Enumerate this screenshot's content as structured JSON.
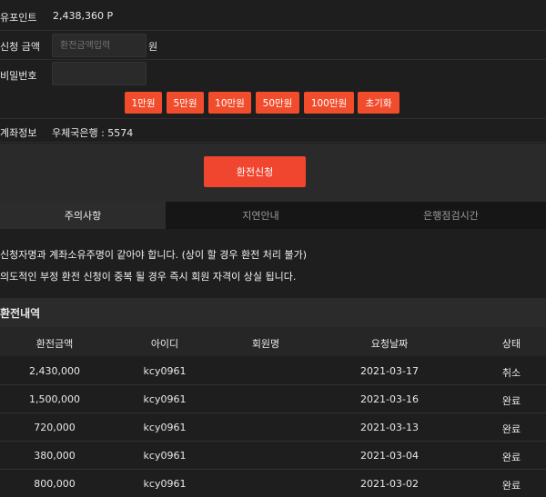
{
  "form": {
    "points_label": "유포인트",
    "points_value": "2,438,360 P",
    "amount_label": "신청 금액",
    "amount_placeholder": "환전금액입력",
    "amount_unit": "원",
    "password_label": "비밀번호",
    "account_label": "계좌정보",
    "account_value": "우체국은행 : 5574"
  },
  "amount_buttons": [
    "1만원",
    "5만원",
    "10만원",
    "50만원",
    "100만원",
    "초기화"
  ],
  "submit_label": "환전신청",
  "tabs": [
    "주의사항",
    "지연안내",
    "은행점검시간"
  ],
  "notices": [
    "신청자명과 계좌소유주명이 같아야 합니다. (상이 할 경우 환전 처리 불가)",
    "의도적인 부정 환전 신청이 중복 될 경우 즉시 회원 자격이 상실 됩니다."
  ],
  "history": {
    "title": "환전내역",
    "columns": [
      "환전금액",
      "아이디",
      "회원명",
      "요청날짜",
      "상태"
    ],
    "rows": [
      [
        "2,430,000",
        "kcy0961",
        "",
        "2021-03-17",
        "취소"
      ],
      [
        "1,500,000",
        "kcy0961",
        "",
        "2021-03-16",
        "완료"
      ],
      [
        "720,000",
        "kcy0961",
        "",
        "2021-03-13",
        "완료"
      ],
      [
        "380,000",
        "kcy0961",
        "",
        "2021-03-04",
        "완료"
      ],
      [
        "800,000",
        "kcy0961",
        "",
        "2021-03-02",
        "완료"
      ]
    ]
  },
  "colors": {
    "accent": "#f14d2d",
    "background": "#1e1e1e",
    "tab_active": "#2c2c2c",
    "tab_inactive": "#161616"
  }
}
